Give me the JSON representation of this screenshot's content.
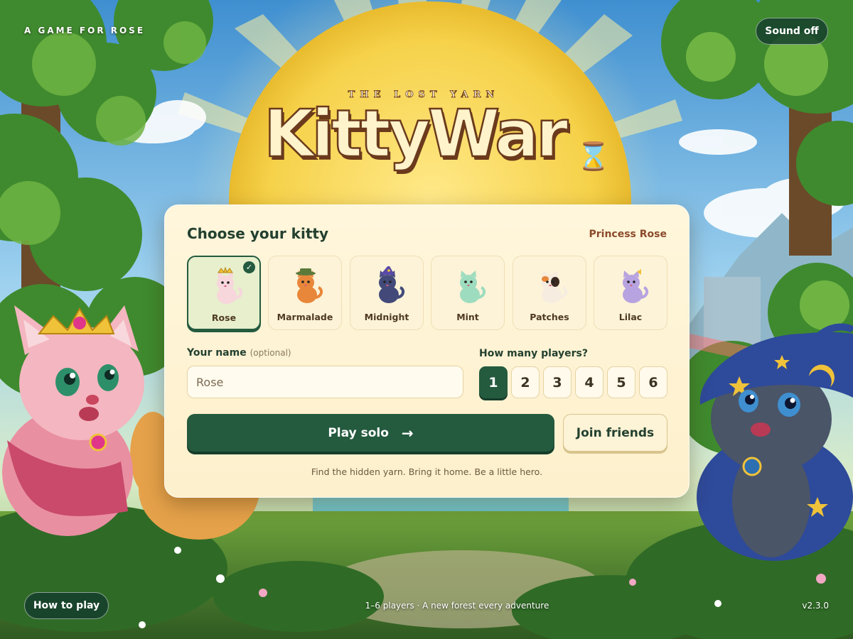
{
  "header": {
    "tagline": "A GAME FOR ROSE",
    "sound_label": "Sound off"
  },
  "hero": {
    "subtitle": "THE LOST YARN",
    "title": "KittyWar",
    "title_glyph": "⌛"
  },
  "card": {
    "heading": "Choose your kitty",
    "player_tag": "Princess Rose",
    "kitties": [
      {
        "name": "Rose",
        "selected": true,
        "icon": "cat-with-crown",
        "color": "#f7d6dc"
      },
      {
        "name": "Marmalade",
        "selected": false,
        "icon": "cat-with-hat",
        "color": "#e8873a"
      },
      {
        "name": "Midnight",
        "selected": false,
        "icon": "cat-with-wizard-hat",
        "color": "#434a7a"
      },
      {
        "name": "Mint",
        "selected": false,
        "icon": "cat",
        "color": "#9edcbf"
      },
      {
        "name": "Patches",
        "selected": false,
        "icon": "calico-cat",
        "color": "#f6ecdf"
      },
      {
        "name": "Lilac",
        "selected": false,
        "icon": "cat-with-bow",
        "color": "#b7a3e0"
      }
    ],
    "selected_check": "✓",
    "name_label": "Your name",
    "name_optional": "(optional)",
    "name_placeholder": "Rose",
    "players_label": "How many players?",
    "player_counts": [
      "1",
      "2",
      "3",
      "4",
      "5",
      "6"
    ],
    "selected_count": "1",
    "play_label": "Play solo",
    "play_arrow": "→",
    "join_label": "Join friends",
    "hint": "Find the hidden yarn. Bring it home. Be a little hero."
  },
  "footer": {
    "howto_label": "How to play",
    "center_text": "1–6 players · A new forest every adventure",
    "version": "v2.3.0"
  },
  "colors": {
    "accent": "#245a3e",
    "card_bg": "#fff6dc",
    "title_outline": "#6b3a1c"
  }
}
